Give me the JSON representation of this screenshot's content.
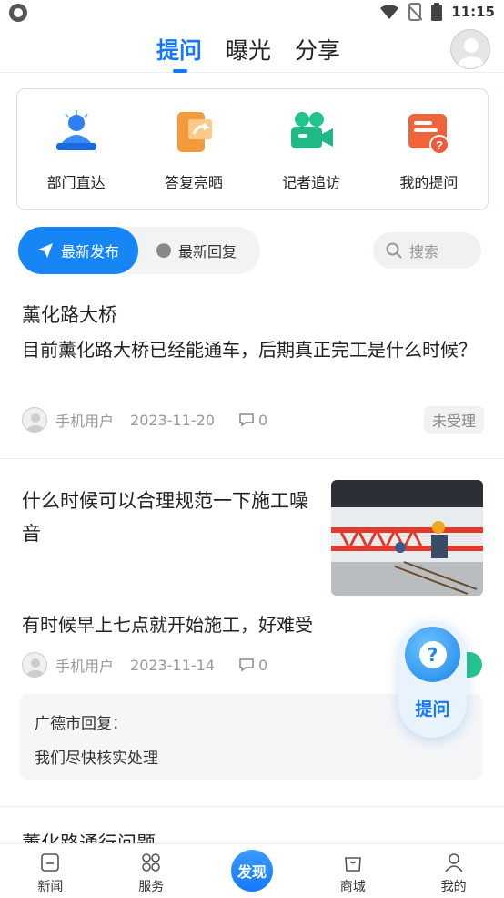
{
  "status_bar": {
    "time": "11:15"
  },
  "top_tabs": [
    {
      "label": "提问",
      "active": true
    },
    {
      "label": "曝光",
      "active": false
    },
    {
      "label": "分享",
      "active": false
    }
  ],
  "quick_entries": [
    {
      "label": "部门直达",
      "icon": "department-icon"
    },
    {
      "label": "答复亮晒",
      "icon": "reply-show-icon"
    },
    {
      "label": "记者追访",
      "icon": "reporter-camera-icon"
    },
    {
      "label": "我的提问",
      "icon": "my-question-icon"
    }
  ],
  "filter": {
    "latest_post_label": "最新发布",
    "latest_reply_label": "最新回复",
    "search_placeholder": "搜索"
  },
  "posts": [
    {
      "title": "薰化路大桥",
      "body": "目前薰化路大桥已经能通车，后期真正完工是什么时候？",
      "user": "手机用户",
      "date": "2023-11-20",
      "comments": "0",
      "status": "未受理"
    },
    {
      "title": "什么时候可以合理规范一下施工噪音",
      "body": "有时候早上七点就开始施工，好难受",
      "user": "手机用户",
      "date": "2023-11-14",
      "comments": "0",
      "reply_from": "广德市回复：",
      "reply_text": "我们尽快核实处理"
    }
  ],
  "next_post_title": "薰化路通行问题",
  "fab": {
    "label": "提问"
  },
  "bottom_nav": [
    {
      "label": "新闻"
    },
    {
      "label": "服务"
    },
    {
      "label": "发现"
    },
    {
      "label": "商城"
    },
    {
      "label": "我的"
    }
  ],
  "colors": {
    "accent": "#1677ff",
    "green": "#26c48f"
  }
}
